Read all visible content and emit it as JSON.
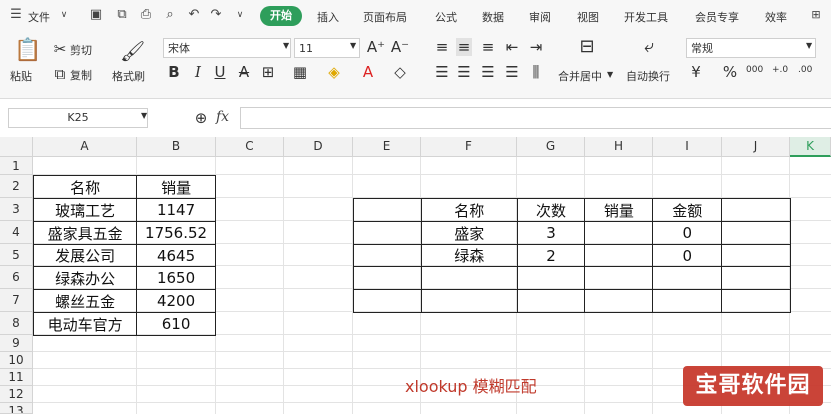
{
  "menubar": {
    "file_label": "文件",
    "tabs": [
      "开始",
      "插入",
      "页面布局",
      "公式",
      "数据",
      "审阅",
      "视图",
      "开发工具",
      "会员专享",
      "效率"
    ]
  },
  "ribbon": {
    "paste": "粘贴",
    "cut": "剪切",
    "copy": "复制",
    "format_painter": "格式刷",
    "font_name": "宋体",
    "font_size": "11",
    "merge_center": "合并居中",
    "wrap_text": "自动换行",
    "number_format": "常规",
    "bold": "B",
    "italic": "I",
    "underline": "U",
    "strike": "A",
    "currency": "¥",
    "percent": "%",
    "thousands": "000",
    "inc_dec": "+.0",
    "dec_dec": ".00"
  },
  "formula_bar": {
    "name_box": "K25",
    "fx": "fx",
    "formula": ""
  },
  "grid": {
    "columns": [
      "A",
      "B",
      "C",
      "D",
      "E",
      "F",
      "G",
      "H",
      "I",
      "J",
      "K"
    ],
    "rows": [
      "1",
      "2",
      "3",
      "4",
      "5",
      "6",
      "7",
      "8",
      "9",
      "10",
      "11",
      "12",
      "13"
    ]
  },
  "table_left": {
    "headers": [
      "名称",
      "销量"
    ],
    "rows": [
      [
        "玻璃工艺",
        "1147"
      ],
      [
        "盛家具五金",
        "1756.52"
      ],
      [
        "发展公司",
        "4645"
      ],
      [
        "绿森办公",
        "1650"
      ],
      [
        "螺丝五金",
        "4200"
      ],
      [
        "电动车官方",
        "610"
      ]
    ]
  },
  "table_right": {
    "headers": [
      "",
      "名称",
      "次数",
      "销量",
      "金额",
      ""
    ],
    "rows": [
      [
        "",
        "盛家",
        "3",
        "",
        "0",
        ""
      ],
      [
        "",
        "绿森",
        "2",
        "",
        "0",
        ""
      ],
      [
        "",
        "",
        "",
        "",
        "",
        ""
      ],
      [
        "",
        "",
        "",
        "",
        "",
        ""
      ]
    ]
  },
  "annotation": "xlookup 模糊匹配",
  "watermark": "宝哥软件园",
  "colors": {
    "accent": "#2e9e5b",
    "annotation": "#c0392b",
    "watermark": "#c83a2e"
  }
}
